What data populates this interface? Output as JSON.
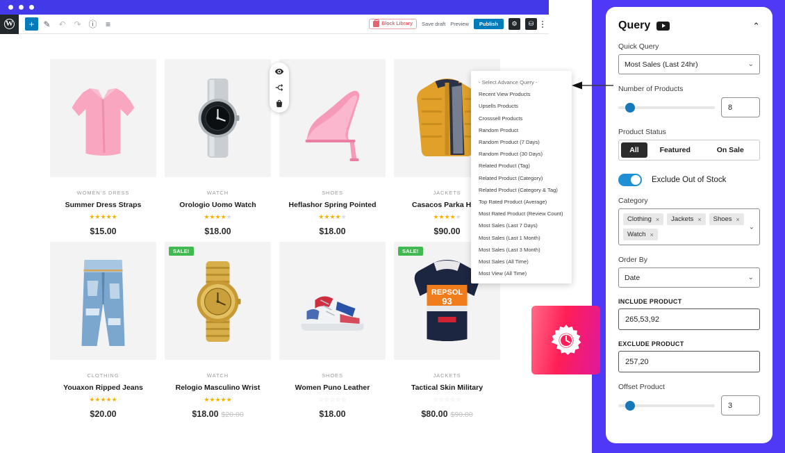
{
  "window": {
    "dots": 3
  },
  "editor_toolbar": {
    "wp_logo": "W",
    "left_buttons": [
      {
        "name": "add-block-button",
        "glyph": "+"
      },
      {
        "name": "edit-pen-button",
        "glyph": "✎"
      },
      {
        "name": "undo-button",
        "glyph": "↶"
      },
      {
        "name": "redo-button",
        "glyph": "↷"
      },
      {
        "name": "info-button",
        "glyph": "ⓘ"
      },
      {
        "name": "list-view-button",
        "glyph": "≡"
      }
    ],
    "block_library_label": "Block Library",
    "save_draft_label": "Save draft",
    "preview_label": "Preview",
    "publish_label": "Publish",
    "settings_icon": "⚙",
    "cart_icon": "⛁",
    "more_menu": "kebab-menu"
  },
  "hover_actions": [
    {
      "name": "quick-view-eye-icon"
    },
    {
      "name": "compare-shuffle-icon"
    },
    {
      "name": "add-to-cart-basket-icon"
    }
  ],
  "products": [
    {
      "category": "WOMEN'S DRESS",
      "name": "Summer Dress Straps",
      "stars": 5,
      "price": "$15.00",
      "old_price": "",
      "sale": false,
      "art": "pink-shirt"
    },
    {
      "category": "WATCH",
      "name": "Orologio Uomo Watch",
      "stars": 4,
      "price": "$18.00",
      "old_price": "",
      "sale": false,
      "art": "silver-watch"
    },
    {
      "category": "SHOES",
      "name": "Heflashor Spring Pointed",
      "stars": 4,
      "price": "$18.00",
      "old_price": "",
      "sale": false,
      "art": "pink-heel"
    },
    {
      "category": "JACKETS",
      "name": "Casacos Parka Hom",
      "stars": 4,
      "price": "$90.00",
      "old_price": "",
      "sale": false,
      "art": "yellow-jacket"
    },
    {
      "category": "CLOTHING",
      "name": "Youaxon Ripped Jeans",
      "stars": 5,
      "price": "$20.00",
      "old_price": "",
      "sale": false,
      "art": "blue-jeans"
    },
    {
      "category": "WATCH",
      "name": "Relogio Masculino Wrist",
      "stars": 5,
      "price": "$18.00",
      "old_price": "$20.00",
      "sale": true,
      "art": "gold-watch"
    },
    {
      "category": "SHOES",
      "name": "Women Puno Leather",
      "stars": 0,
      "price": "$18.00",
      "old_price": "",
      "sale": false,
      "art": "sneakers"
    },
    {
      "category": "JACKETS",
      "name": "Tactical Skin Military",
      "stars": 0,
      "price": "$80.00",
      "old_price": "$90.00",
      "sale": true,
      "art": "repsol-hoodie"
    }
  ],
  "sale_badge_label": "SALE!",
  "advance_query_dropdown": {
    "options": [
      "- Select Advance Query -",
      "Recent View Products",
      "Upsells Products",
      "Crosssell Products",
      "Random Product",
      "Random Product (7 Days)",
      "Random Product (30 Days)",
      "Related Product (Tag)",
      "Related Product (Category)",
      "Related Product (Category & Tag)",
      "Top Rated Product (Average)",
      "Most Rated Product (Review Count)",
      "Most Sales (Last 7 Days)",
      "Most Sales (Last 1 Month)",
      "Most Sales (Last 3 Month)",
      "Most Sales (All Time)",
      "Most View (All Time)"
    ]
  },
  "gear_widget": {
    "icon": "gear-clock-icon",
    "gradient_from": "#ff6b8a",
    "gradient_to": "#e0199b"
  },
  "query_panel": {
    "title": "Query",
    "video_icon": "youtube-play-icon",
    "collapse_icon": "chevron-up-icon",
    "quick_query": {
      "label": "Quick Query",
      "value": "Most Sales (Last 24hr)"
    },
    "number_of_products": {
      "label": "Number of Products",
      "value": "8",
      "slider_percent": 7
    },
    "product_status": {
      "label": "Product Status",
      "options": [
        "All",
        "Featured",
        "On Sale"
      ],
      "selected": "All"
    },
    "exclude_out_of_stock": {
      "label": "Exclude Out of Stock",
      "enabled": true
    },
    "category": {
      "label": "Category",
      "chips": [
        "Clothing",
        "Jackets",
        "Shoes",
        "Watch"
      ],
      "remove_glyph": "×"
    },
    "order_by": {
      "label": "Order By",
      "value": "Date"
    },
    "include_product": {
      "label": "INCLUDE PRODUCT",
      "value": "265,53,92"
    },
    "exclude_product": {
      "label": "EXCLUDE PRODUCT",
      "value": "257,20"
    },
    "offset_product": {
      "label": "Offset Product",
      "value": "3",
      "slider_percent": 7
    },
    "accent_color": "#1679bb",
    "panel_bg": "#4f39f6"
  }
}
